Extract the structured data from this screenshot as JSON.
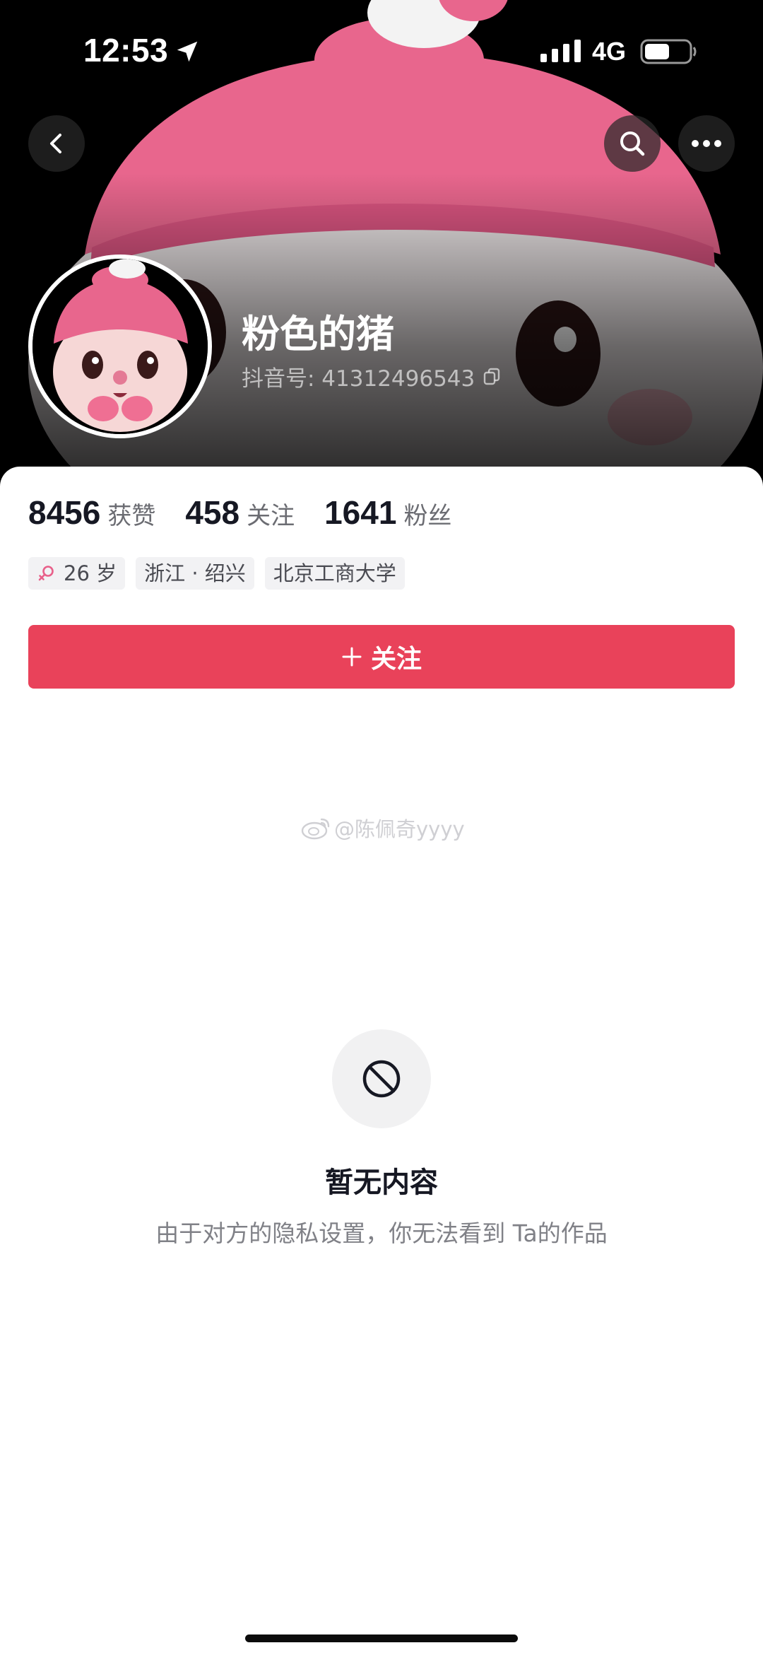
{
  "status_bar": {
    "time": "12:53",
    "network": "4G",
    "icons": [
      "location-arrow-icon",
      "signal-icon",
      "battery-icon"
    ]
  },
  "header": {
    "icons": [
      "back-icon",
      "search-icon",
      "more-icon"
    ]
  },
  "profile": {
    "nickname": "粉色的猪",
    "douyin_id": "抖音号: 41312496543"
  },
  "stats": [
    {
      "value": "8456",
      "label": "获赞"
    },
    {
      "value": "458",
      "label": "关注"
    },
    {
      "value": "1641",
      "label": "粉丝"
    }
  ],
  "tags": {
    "age": "26 岁",
    "location": "浙江 · 绍兴",
    "school": "北京工商大学"
  },
  "follow_button": {
    "label": "关注"
  },
  "watermark": "@陈佩奇yyyy",
  "empty_state": {
    "icon": "block-icon",
    "title": "暂无内容",
    "description": "由于对方的隐私设置，你无法看到 Ta的作品"
  },
  "colors": {
    "accent": "#e9425a",
    "primary_text": "#161823",
    "secondary_text": "#6b6c72",
    "tag_bg": "#f2f2f4",
    "banner_pink": "#e8668d"
  }
}
